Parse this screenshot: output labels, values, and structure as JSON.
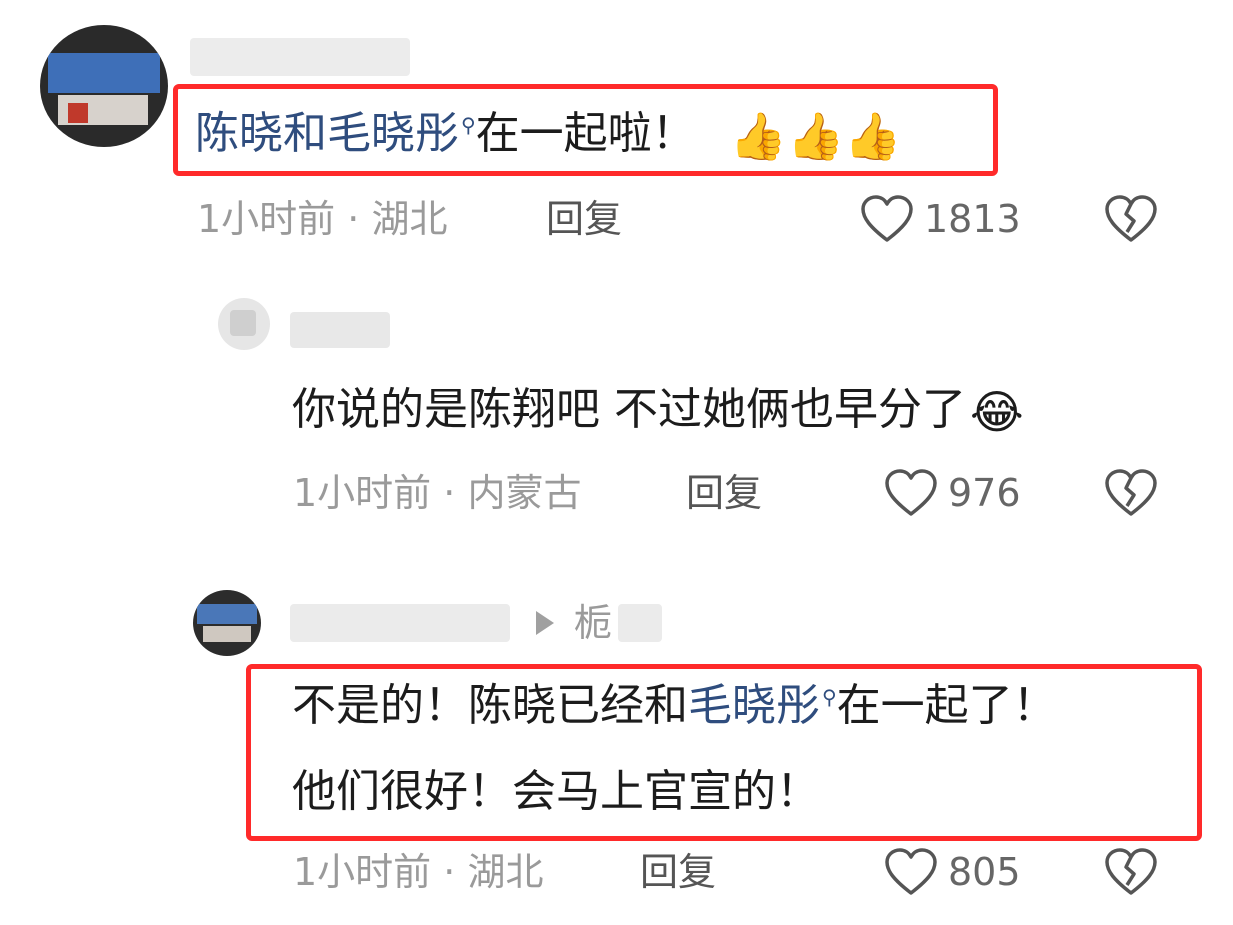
{
  "comments": [
    {
      "text_link": "陈晓和毛晓彤",
      "text_after": "在一起啦！",
      "emojis": [
        "👍",
        "👍",
        "👍"
      ],
      "time": "1小时前",
      "location": "湖北",
      "reply_label": "回复",
      "likes": "1813"
    },
    {
      "text": "你说的是陈翔吧 不过她俩也早分了",
      "emoji": "😂",
      "time": "1小时前",
      "location": "内蒙古",
      "reply_label": "回复",
      "likes": "976"
    },
    {
      "reply_target": "栀",
      "line1_before": "不是的！陈晓已经和",
      "line1_link": "毛晓彤",
      "line1_after": "在一起了！",
      "line2": "他们很好！会马上官宣的！",
      "time": "1小时前",
      "location": "湖北",
      "reply_label": "回复",
      "likes": "805"
    }
  ],
  "meta_separator": "·",
  "colors": {
    "highlight": "#ff2a2a",
    "link": "#2f4d7e",
    "meta": "#9a9a9a"
  }
}
